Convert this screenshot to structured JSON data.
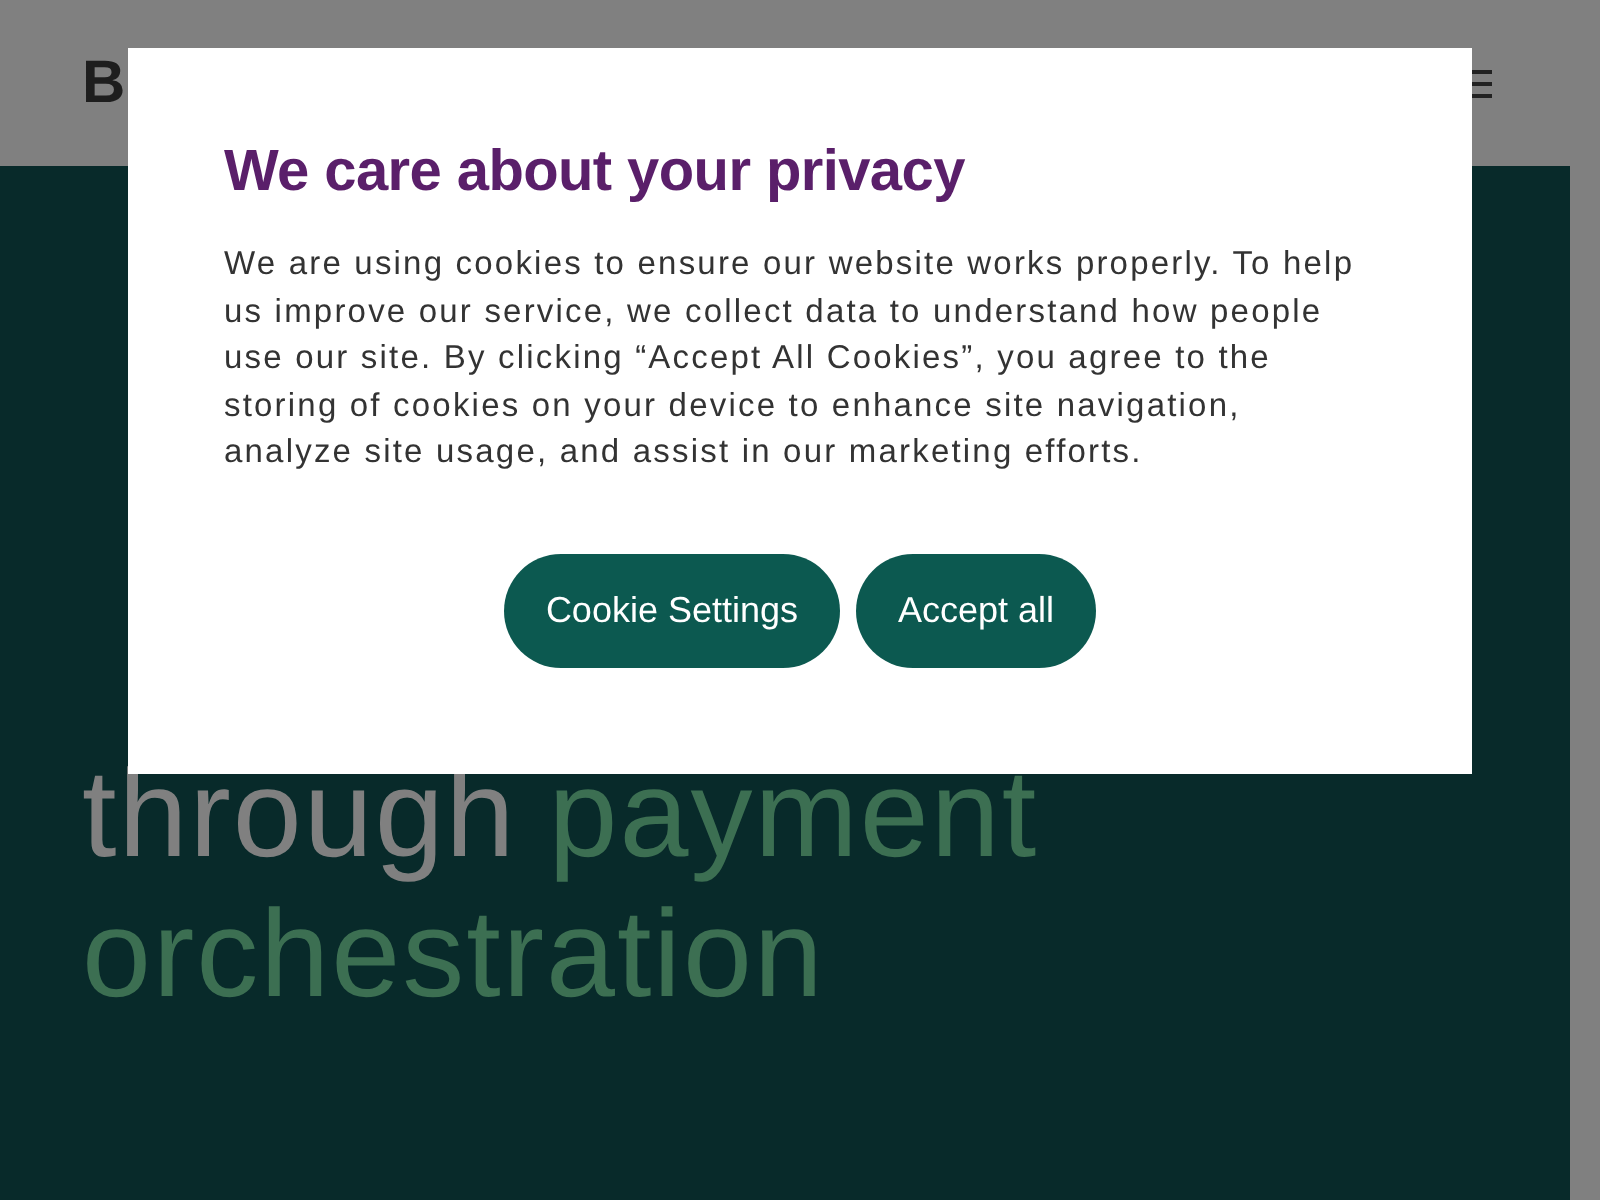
{
  "header": {
    "logo": "B"
  },
  "hero": {
    "lines": [
      [
        {
          "text": "through",
          "highlight": false
        },
        {
          "text": "payment",
          "highlight": true
        }
      ],
      [
        {
          "text": "orchestration",
          "highlight": true
        }
      ]
    ]
  },
  "cookie_dialog": {
    "title": "We care about your privacy",
    "body": "We are using cookies to ensure our website works properly. To help us improve our service, we collect data to understand how people use our site. By clicking “Accept All Cookies”, you agree to the storing of cookies on your device to enhance site navigation, analyze site usage, and assist in our marketing efforts.",
    "buttons": [
      "Cookie Settings",
      "Accept all"
    ]
  }
}
